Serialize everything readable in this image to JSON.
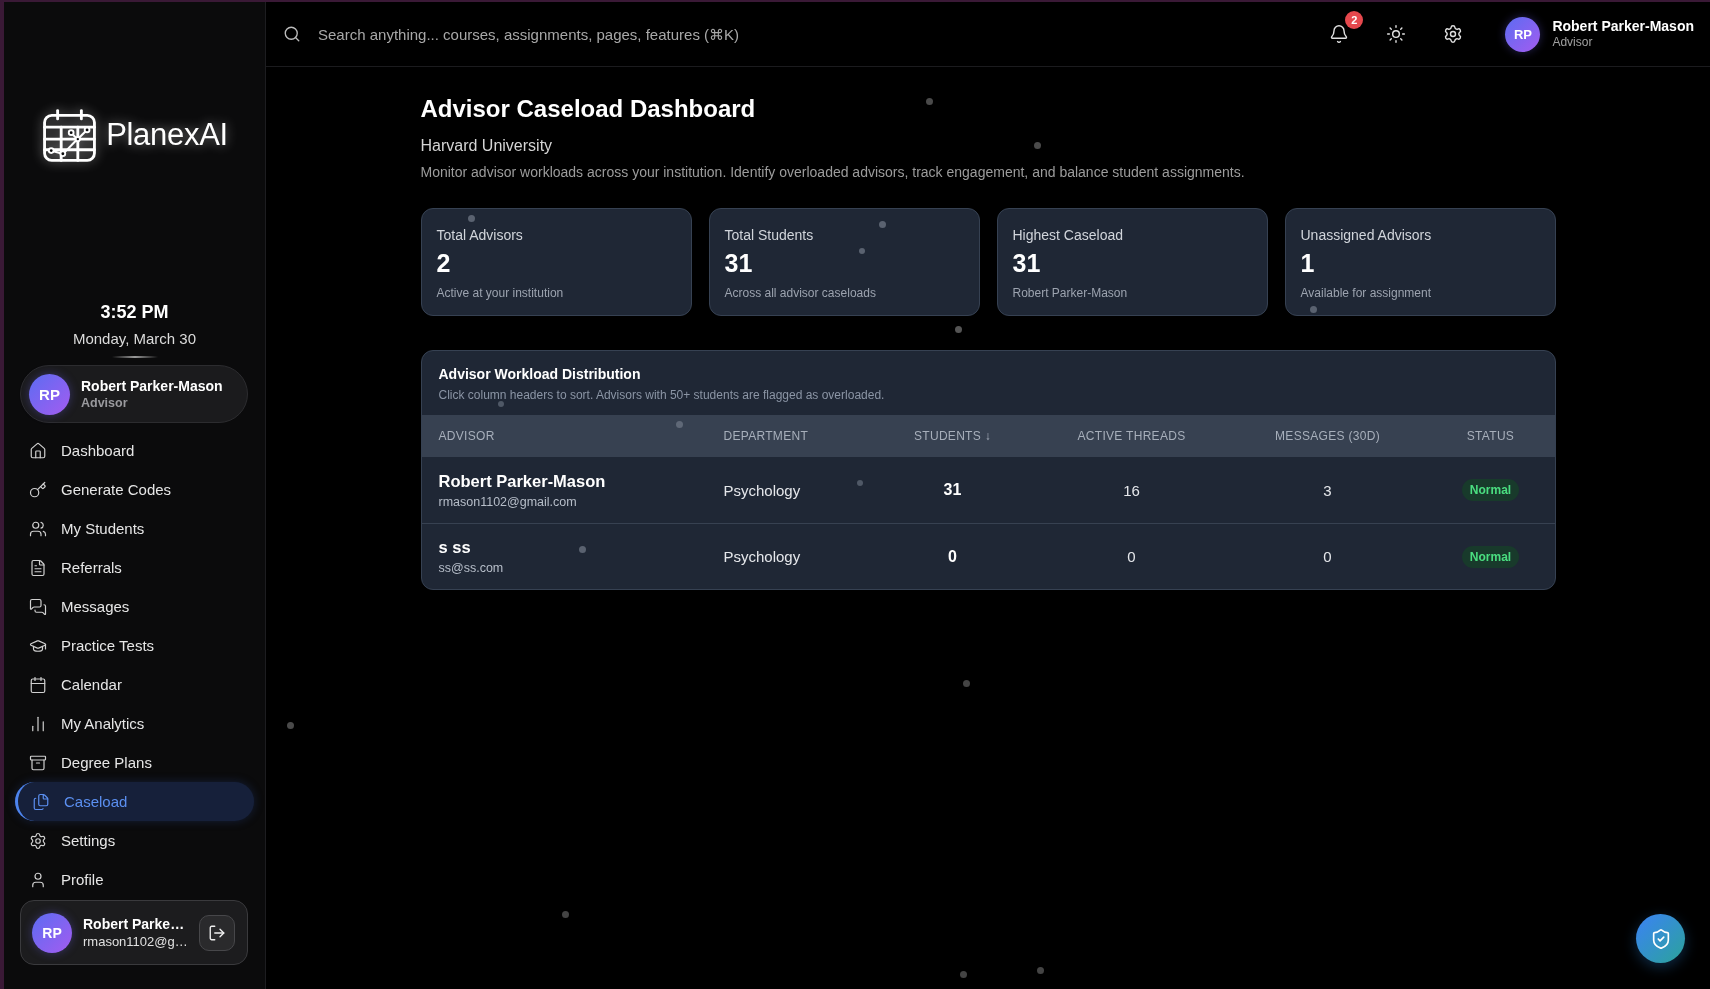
{
  "sidebar": {
    "logo": {
      "name": "PlanexAI"
    },
    "clock": {
      "time": "3:52 PM",
      "date": "Monday, March 30"
    },
    "profile": {
      "initials": "RP",
      "name": "Robert Parker-Mason",
      "role": "Advisor"
    },
    "nav_items": [
      {
        "label": "Dashboard",
        "selected": false
      },
      {
        "label": "Generate Codes",
        "selected": false
      },
      {
        "label": "My Students",
        "selected": false
      },
      {
        "label": "Referrals",
        "selected": false
      },
      {
        "label": "Messages",
        "selected": false
      },
      {
        "label": "Practice Tests",
        "selected": false
      },
      {
        "label": "Calendar",
        "selected": false
      },
      {
        "label": "My Analytics",
        "selected": false
      },
      {
        "label": "Degree Plans",
        "selected": false
      },
      {
        "label": "Caseload",
        "selected": true
      },
      {
        "label": "Settings",
        "selected": false
      },
      {
        "label": "Profile",
        "selected": false
      }
    ],
    "account": {
      "initials": "RP",
      "name": "Robert Parke…",
      "email": "rmason1102@g…"
    }
  },
  "top_bar": {
    "search": {
      "placeholder": "Search anything... courses, assignments, pages, features (⌘K)"
    },
    "notification_count": "2",
    "user": {
      "initials": "RP",
      "name": "Robert Parker-Mason",
      "role": "Advisor"
    }
  },
  "page": {
    "title": "Advisor Caseload Dashboard",
    "institution": "Harvard University",
    "description": "Monitor advisor workloads across your institution. Identify overloaded advisors, track engagement, and balance student assignments."
  },
  "stats": [
    {
      "label": "Total Advisors",
      "value": "2",
      "note": "Active at your institution"
    },
    {
      "label": "Total Students",
      "value": "31",
      "note": "Across all advisor caseloads"
    },
    {
      "label": "Highest Caseload",
      "value": "31",
      "note": "Robert Parker-Mason"
    },
    {
      "label": "Unassigned Advisors",
      "value": "1",
      "note": "Available for assignment"
    }
  ],
  "workload": {
    "title": "Advisor Workload Distribution",
    "subtitle": "Click column headers to sort. Advisors with 50+ students are flagged as overloaded.",
    "columns": [
      "ADVISOR",
      "DEPARTMENT",
      "STUDENTS ↓",
      "ACTIVE THREADS",
      "MESSAGES (30D)",
      "STATUS"
    ],
    "rows": [
      {
        "name": "Robert Parker-Mason",
        "email": "rmason1102@gmail.com",
        "department": "Psychology",
        "students": "31",
        "active_threads": "16",
        "messages_30d": "3",
        "status": "Normal"
      },
      {
        "name": "s ss",
        "email": "ss@ss.com",
        "department": "Psychology",
        "students": "0",
        "active_threads": "0",
        "messages_30d": "0",
        "status": "Normal"
      }
    ]
  }
}
